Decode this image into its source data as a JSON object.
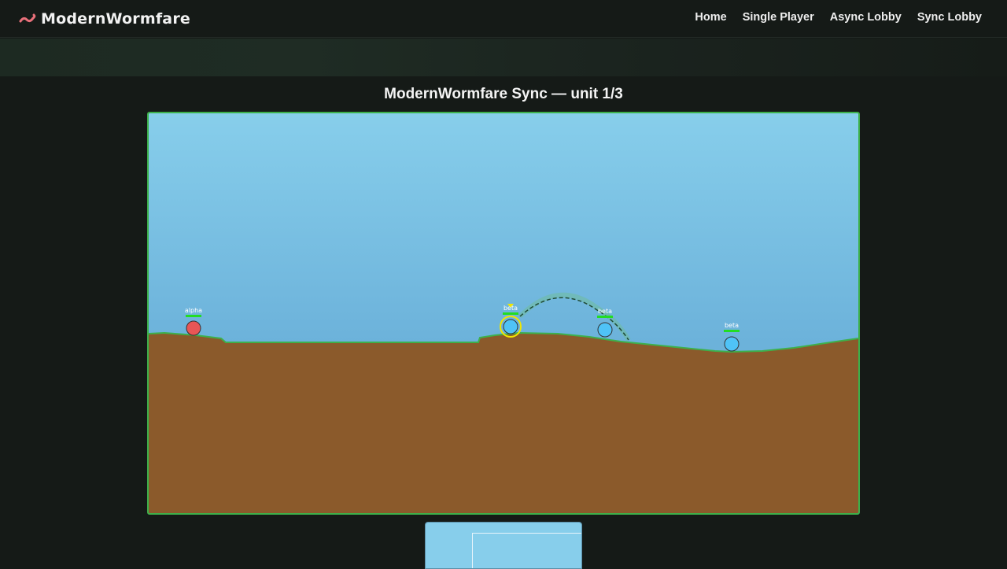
{
  "brand": {
    "name": "ModernWormfare",
    "icon": "worm-icon"
  },
  "nav": {
    "links": [
      "Home",
      "Single Player",
      "Async Lobby",
      "Sync Lobby"
    ]
  },
  "game": {
    "title": "ModernWormfare Sync — unit 1/3",
    "units": [
      {
        "name": "alpha",
        "team": "red",
        "color": "#e85656",
        "active": false
      },
      {
        "name": "beta",
        "team": "blue",
        "color": "#4fc3f7",
        "active": true
      },
      {
        "name": "beta",
        "team": "blue",
        "color": "#4fc3f7",
        "active": false
      },
      {
        "name": "beta",
        "team": "blue",
        "color": "#4fc3f7",
        "active": false
      }
    ]
  },
  "colors": {
    "sky_top": "#87ceeb",
    "sky_bottom": "#5ea6d0",
    "terrain": "#8b5a2b",
    "terrain_edge": "#3db04b",
    "active_ring": "#f2e600",
    "health_bar": "#22dd22"
  }
}
